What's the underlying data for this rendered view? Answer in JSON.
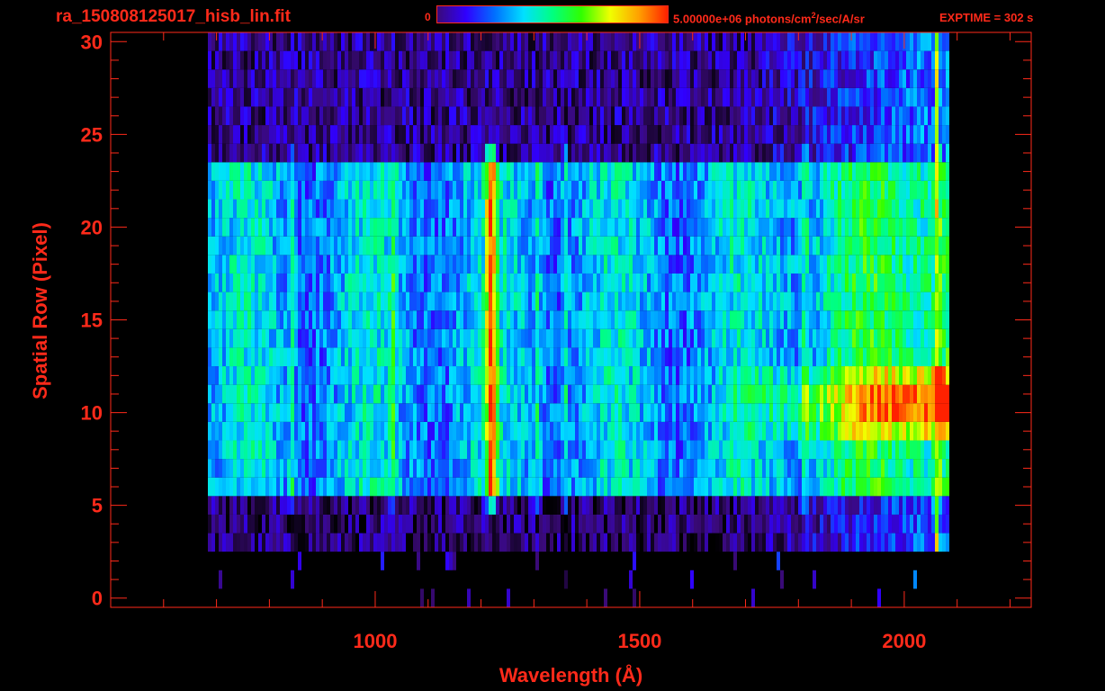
{
  "header": {
    "title": "ra_150808125017_hisb_lin.fit",
    "colorbar_min": "0",
    "colorbar_max_prefix": "5.00000e+06 photons/cm",
    "colorbar_max_sup": "2",
    "colorbar_max_suffix": "/sec/A/sr",
    "exptime": "EXPTIME = 302 s"
  },
  "colors": {
    "axis": "#ff2a1a",
    "background": "#000000",
    "colormap": [
      "#000000",
      "#3a0a78",
      "#3000ff",
      "#0070ff",
      "#00e0ff",
      "#00ff80",
      "#30ff00",
      "#f0ff00",
      "#ffa000",
      "#ff2000"
    ]
  },
  "chart_data": {
    "type": "heatmap",
    "title": "ra_150808125017_hisb_lin.fit",
    "xlabel": "Wavelength (Å)",
    "ylabel": "Spatial Row (Pixel)",
    "xlim": [
      500,
      2240
    ],
    "ylim": [
      -0.5,
      30.5
    ],
    "x_ticks": [
      1000,
      1500,
      2000
    ],
    "y_ticks": [
      0,
      5,
      10,
      15,
      20,
      25,
      30
    ],
    "colorbar_range": [
      0,
      5000000
    ],
    "colorbar_unit": "photons/cm^2/sec/A/sr",
    "x_tick_labels": [
      "1000",
      "1500",
      "2000"
    ],
    "y_tick_labels": [
      "0",
      "5",
      "10",
      "15",
      "20",
      "25",
      "30"
    ],
    "detector_extent_angstrom": [
      680,
      2060
    ],
    "bright_rows": [
      6,
      23
    ],
    "emission_lines_angstrom": [
      840,
      1030,
      1216,
      1304,
      1356,
      1810,
      2060
    ],
    "peak_rows": [
      9,
      12
    ]
  }
}
